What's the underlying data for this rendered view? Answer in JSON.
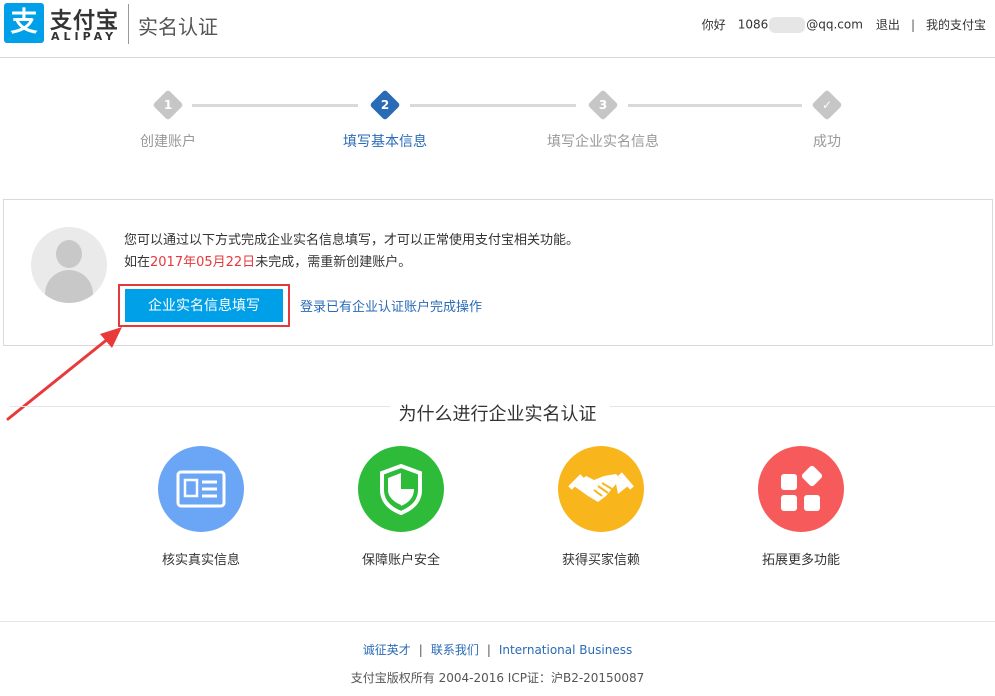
{
  "header": {
    "logo_char": "支",
    "logo_cn": "支付宝",
    "logo_en": "ALIPAY",
    "page_title": "实名认证",
    "greeting": "你好",
    "email_prefix": "1086",
    "email_suffix": "@qq.com",
    "logout": "退出",
    "separator": "|",
    "my_alipay": "我的支付宝"
  },
  "steps": [
    {
      "number": "1",
      "label": "创建账户",
      "state": "done"
    },
    {
      "number": "2",
      "label": "填写基本信息",
      "state": "active"
    },
    {
      "number": "3",
      "label": "填写企业实名信息",
      "state": "pending"
    },
    {
      "number": "✓",
      "label": "成功",
      "state": "pending"
    }
  ],
  "panel": {
    "line1": "您可以通过以下方式完成企业实名信息填写，才可以正常使用支付宝相关功能。",
    "line2_prefix": "如在",
    "line2_date": "2017年05月22日",
    "line2_suffix": "未完成，需重新创建账户。",
    "primary_button": "企业实名信息填写",
    "login_link": "登录已有企业认证账户完成操作"
  },
  "why": {
    "title": "为什么进行企业实名认证",
    "features": [
      {
        "label": "核实真实信息",
        "icon": "id-card-icon",
        "color": "#6aa6f5"
      },
      {
        "label": "保障账户安全",
        "icon": "shield-icon",
        "color": "#2dbb39"
      },
      {
        "label": "获得买家信赖",
        "icon": "handshake-icon",
        "color": "#f8b51c"
      },
      {
        "label": "拓展更多功能",
        "icon": "apps-icon",
        "color": "#f65a5a"
      }
    ]
  },
  "footer": {
    "links": [
      "诚征英才",
      "联系我们",
      "International Business"
    ],
    "separator": "|",
    "copyright": "支付宝版权所有 2004-2016 ICP证：沪B2-20150087"
  },
  "colors": {
    "brand": "#00a0e9",
    "step_active": "#2a6bb7",
    "highlight_red": "#e4393c"
  }
}
